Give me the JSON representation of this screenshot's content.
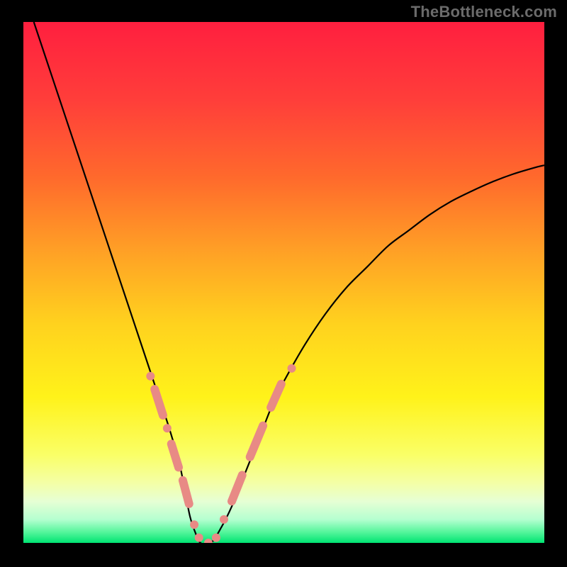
{
  "watermark": "TheBottleneck.com",
  "chart_data": {
    "type": "line",
    "title": "",
    "xlabel": "",
    "ylabel": "",
    "xlim": [
      0,
      100
    ],
    "ylim": [
      0,
      100
    ],
    "grid": false,
    "legend": false,
    "background_gradient_stops": [
      {
        "offset": 0.0,
        "color": "#ff1f3f"
      },
      {
        "offset": 0.15,
        "color": "#ff3e3a"
      },
      {
        "offset": 0.3,
        "color": "#ff6a2c"
      },
      {
        "offset": 0.45,
        "color": "#ffa425"
      },
      {
        "offset": 0.58,
        "color": "#ffd21e"
      },
      {
        "offset": 0.72,
        "color": "#fff21a"
      },
      {
        "offset": 0.83,
        "color": "#faff66"
      },
      {
        "offset": 0.885,
        "color": "#f4ffa6"
      },
      {
        "offset": 0.92,
        "color": "#e6ffd4"
      },
      {
        "offset": 0.955,
        "color": "#b5ffd0"
      },
      {
        "offset": 0.98,
        "color": "#52f59a"
      },
      {
        "offset": 1.0,
        "color": "#00e472"
      }
    ],
    "series": [
      {
        "name": "bottleneck-curve",
        "color": "#000000",
        "x": [
          2,
          4,
          6,
          8,
          10,
          12,
          14,
          16,
          18,
          20,
          22,
          24,
          26,
          28,
          30,
          31,
          32,
          33,
          34,
          36,
          38,
          40,
          42,
          44,
          46,
          48,
          50,
          54,
          58,
          62,
          66,
          70,
          74,
          78,
          82,
          86,
          90,
          94,
          98,
          100
        ],
        "y": [
          100,
          94,
          88,
          82,
          76,
          70,
          64,
          58,
          52,
          46,
          40,
          34,
          28,
          22,
          15,
          10,
          5,
          2,
          0,
          0,
          3,
          7,
          12,
          17,
          22,
          27,
          31,
          38,
          44,
          49,
          53,
          57,
          60,
          63,
          65.5,
          67.5,
          69.3,
          70.8,
          72,
          72.5
        ]
      }
    ],
    "dot_overlay": {
      "name": "highlight-dots",
      "color": "#e88a85",
      "radius_css_px": 6,
      "capsules": [
        {
          "x1": 24.4,
          "y1": 32.0,
          "x2": 24.4,
          "y2": 32.0
        },
        {
          "x1": 25.2,
          "y1": 29.5,
          "x2": 26.8,
          "y2": 24.5
        },
        {
          "x1": 27.6,
          "y1": 22.0,
          "x2": 27.6,
          "y2": 22.0
        },
        {
          "x1": 28.4,
          "y1": 19.0,
          "x2": 29.8,
          "y2": 14.5
        },
        {
          "x1": 30.6,
          "y1": 12.0,
          "x2": 31.8,
          "y2": 7.5
        },
        {
          "x1": 32.8,
          "y1": 3.5,
          "x2": 32.8,
          "y2": 3.5
        },
        {
          "x1": 33.7,
          "y1": 1.0,
          "x2": 33.7,
          "y2": 1.0
        },
        {
          "x1": 35.5,
          "y1": 0.0,
          "x2": 35.5,
          "y2": 0.0
        },
        {
          "x1": 37.0,
          "y1": 1.0,
          "x2": 37.0,
          "y2": 1.0
        },
        {
          "x1": 38.5,
          "y1": 4.5,
          "x2": 38.5,
          "y2": 4.5
        },
        {
          "x1": 40.0,
          "y1": 8.0,
          "x2": 42.0,
          "y2": 13.0
        },
        {
          "x1": 43.5,
          "y1": 16.5,
          "x2": 46.0,
          "y2": 22.5
        },
        {
          "x1": 47.5,
          "y1": 26.0,
          "x2": 49.5,
          "y2": 30.5
        },
        {
          "x1": 51.5,
          "y1": 33.5,
          "x2": 51.5,
          "y2": 33.5
        }
      ]
    }
  }
}
